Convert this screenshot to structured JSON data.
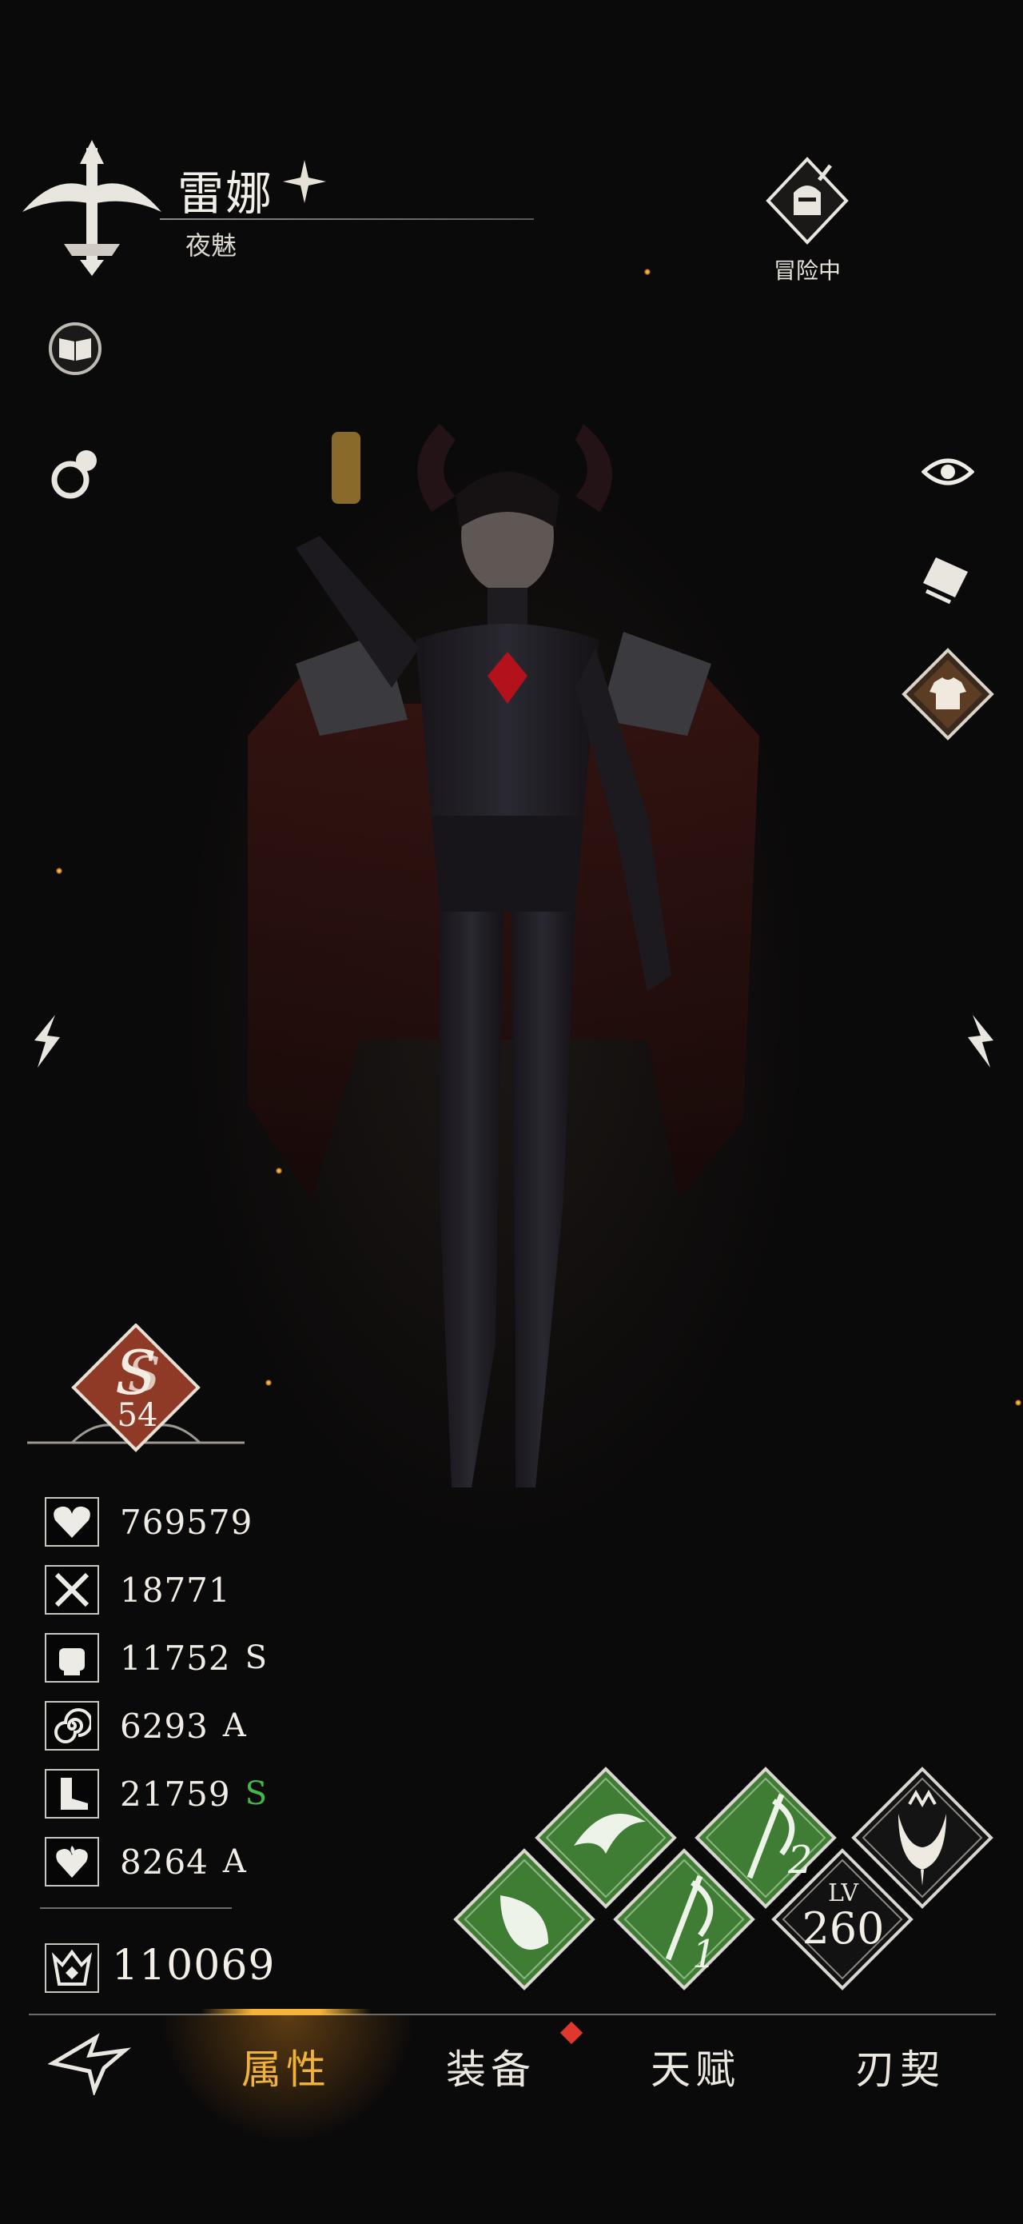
{
  "header": {
    "name": "雷娜",
    "title": "夜魅",
    "status": "冒险中"
  },
  "grade": {
    "level": "54"
  },
  "stats": [
    {
      "icon": "heart-icon",
      "value": "769579",
      "grade": ""
    },
    {
      "icon": "crossed-swords-icon",
      "value": "18771",
      "grade": ""
    },
    {
      "icon": "fist-icon",
      "value": "11752",
      "grade": "S"
    },
    {
      "icon": "spiral-icon",
      "value": "6293",
      "grade": "A"
    },
    {
      "icon": "boot-icon",
      "value": "21759",
      "grade": "S"
    },
    {
      "icon": "flaming-heart-icon",
      "value": "8264",
      "grade": "A"
    }
  ],
  "power": {
    "value": "110069"
  },
  "skills": {
    "slot1_number": "1",
    "slot2_number": "2",
    "lv_label": "LV",
    "lv_value": "260"
  },
  "nav": {
    "tabs": [
      "属性",
      "装备",
      "天赋",
      "刃契"
    ],
    "active": 0
  },
  "colors": {
    "accent": "#f1b23a",
    "grade_green": "#42b84a",
    "skill_green": "#3f7d35",
    "grade_red": "#8f3a27"
  }
}
